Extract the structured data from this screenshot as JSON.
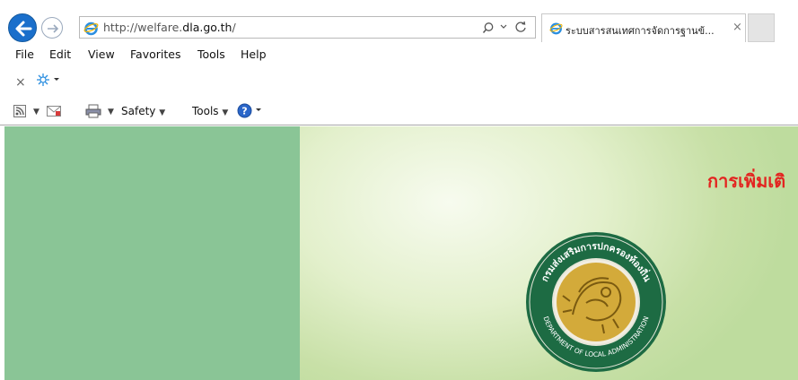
{
  "browser": {
    "url_prefix": "http://welfare.",
    "url_domain": "dla.go.th",
    "url_suffix": "/",
    "tab_title": "ระบบสารสนเทศการจัดการฐานข้...",
    "tab_close": "×"
  },
  "menu_bar": [
    "File",
    "Edit",
    "View",
    "Favorites",
    "Tools",
    "Help"
  ],
  "command_bar": {
    "safety_label": "Safety",
    "tools_label": "Tools"
  },
  "page": {
    "heading": "การเพิ่มเติ",
    "logo_text_top": "กรมส่งเสริมการปกครองท้องถิ่น",
    "logo_text_bottom": "DEPARTMENT OF LOCAL ADMINISTRATION"
  },
  "colors": {
    "left_panel": "#8ac596",
    "heading": "#e32420",
    "logo_ring": "#1d6b43",
    "logo_gold": "#c9a227"
  }
}
